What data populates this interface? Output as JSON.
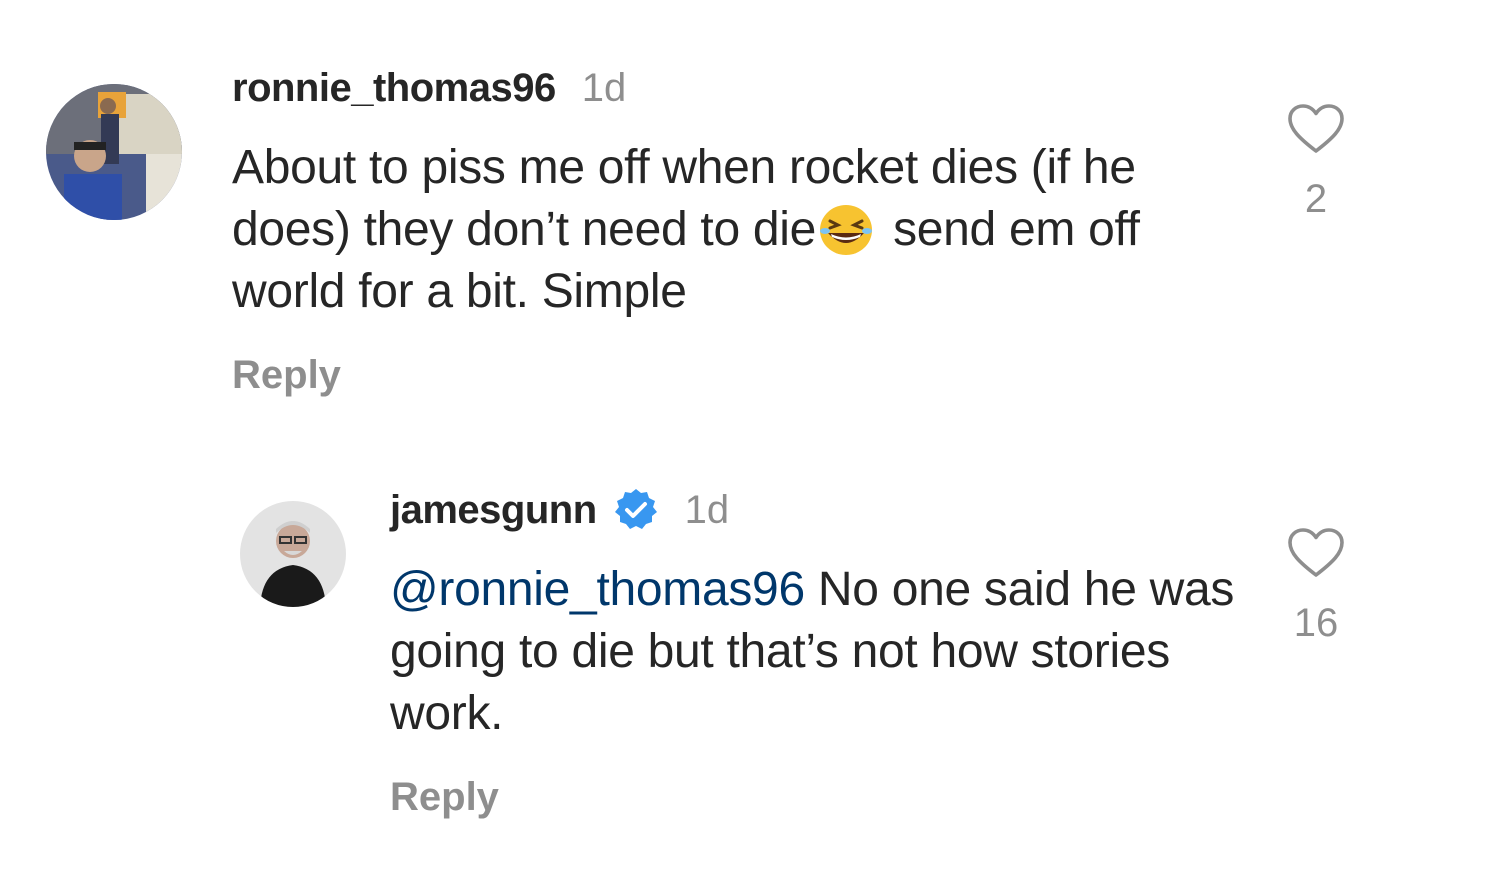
{
  "comments": [
    {
      "username": "ronnie_thomas96",
      "time": "1d",
      "text_part1": "About to piss me off when rocket dies (if he does) they don’t need to die",
      "emoji": "grinning-squinting-face-emoji",
      "text_part2": " send em off world for a bit. Simple",
      "reply_label": "Reply",
      "like_count": "2",
      "verified": false
    },
    {
      "username": "jamesgunn",
      "time": "1d",
      "mention": "@ronnie_thomas96",
      "text": " No one said he was going to die but that’s not how stories work.",
      "reply_label": "Reply",
      "like_count": "16",
      "verified": true
    }
  ],
  "colors": {
    "text": "#262626",
    "secondary": "#8e8e8e",
    "mention": "#00376b",
    "verified_badge": "#3897f0"
  },
  "icons": {
    "like": "heart-outline-icon",
    "verified": "verified-badge-icon"
  }
}
